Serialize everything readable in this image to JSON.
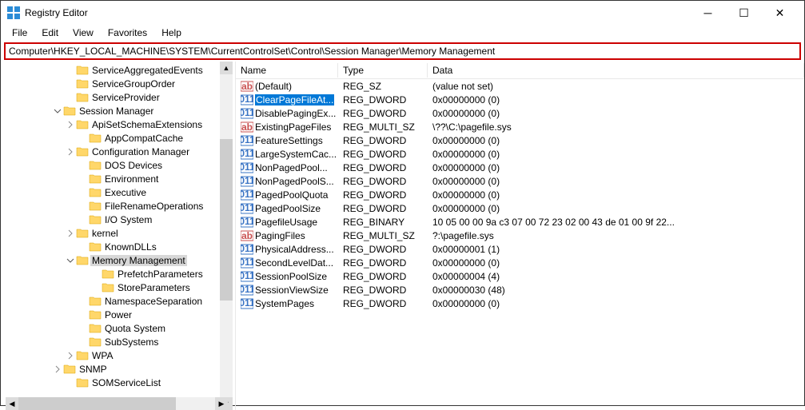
{
  "window": {
    "title": "Registry Editor"
  },
  "menu": {
    "file": "File",
    "edit": "Edit",
    "view": "View",
    "favorites": "Favorites",
    "help": "Help"
  },
  "address": "Computer\\HKEY_LOCAL_MACHINE\\SYSTEM\\CurrentControlSet\\Control\\Session Manager\\Memory Management",
  "tree": [
    {
      "depth": 5,
      "expander": "",
      "label": "ServiceAggregatedEvents",
      "selected": false
    },
    {
      "depth": 5,
      "expander": "",
      "label": "ServiceGroupOrder",
      "selected": false
    },
    {
      "depth": 5,
      "expander": "",
      "label": "ServiceProvider",
      "selected": false
    },
    {
      "depth": 4,
      "expander": "v",
      "label": "Session Manager",
      "selected": false,
      "hasExpander": true
    },
    {
      "depth": 5,
      "expander": ">",
      "label": "ApiSetSchemaExtensions",
      "selected": false,
      "hasExpander": true
    },
    {
      "depth": 6,
      "expander": "",
      "label": "AppCompatCache",
      "selected": false
    },
    {
      "depth": 5,
      "expander": ">",
      "label": "Configuration Manager",
      "selected": false,
      "hasExpander": true
    },
    {
      "depth": 6,
      "expander": "",
      "label": "DOS Devices",
      "selected": false
    },
    {
      "depth": 6,
      "expander": "",
      "label": "Environment",
      "selected": false
    },
    {
      "depth": 6,
      "expander": "",
      "label": "Executive",
      "selected": false
    },
    {
      "depth": 6,
      "expander": "",
      "label": "FileRenameOperations",
      "selected": false
    },
    {
      "depth": 6,
      "expander": "",
      "label": "I/O System",
      "selected": false
    },
    {
      "depth": 5,
      "expander": ">",
      "label": "kernel",
      "selected": false,
      "hasExpander": true
    },
    {
      "depth": 6,
      "expander": "",
      "label": "KnownDLLs",
      "selected": false
    },
    {
      "depth": 5,
      "expander": "v",
      "label": "Memory Management",
      "selected": true,
      "hasExpander": true
    },
    {
      "depth": 7,
      "expander": "",
      "label": "PrefetchParameters",
      "selected": false
    },
    {
      "depth": 7,
      "expander": "",
      "label": "StoreParameters",
      "selected": false
    },
    {
      "depth": 6,
      "expander": "",
      "label": "NamespaceSeparation",
      "selected": false
    },
    {
      "depth": 6,
      "expander": "",
      "label": "Power",
      "selected": false
    },
    {
      "depth": 6,
      "expander": "",
      "label": "Quota System",
      "selected": false
    },
    {
      "depth": 6,
      "expander": "",
      "label": "SubSystems",
      "selected": false
    },
    {
      "depth": 5,
      "expander": ">",
      "label": "WPA",
      "selected": false,
      "hasExpander": true
    },
    {
      "depth": 4,
      "expander": ">",
      "label": "SNMP",
      "selected": false,
      "hasExpander": true
    },
    {
      "depth": 5,
      "expander": "",
      "label": "SOMServiceList",
      "selected": false
    }
  ],
  "columns": {
    "name": "Name",
    "type": "Type",
    "data": "Data"
  },
  "values": [
    {
      "icon": "str",
      "name": "(Default)",
      "type": "REG_SZ",
      "data": "(value not set)",
      "selected": false
    },
    {
      "icon": "bin",
      "name": "ClearPageFileAt...",
      "type": "REG_DWORD",
      "data": "0x00000000 (0)",
      "selected": true
    },
    {
      "icon": "bin",
      "name": "DisablePagingEx...",
      "type": "REG_DWORD",
      "data": "0x00000000 (0)",
      "selected": false
    },
    {
      "icon": "str",
      "name": "ExistingPageFiles",
      "type": "REG_MULTI_SZ",
      "data": "\\??\\C:\\pagefile.sys",
      "selected": false
    },
    {
      "icon": "bin",
      "name": "FeatureSettings",
      "type": "REG_DWORD",
      "data": "0x00000000 (0)",
      "selected": false
    },
    {
      "icon": "bin",
      "name": "LargeSystemCac...",
      "type": "REG_DWORD",
      "data": "0x00000000 (0)",
      "selected": false
    },
    {
      "icon": "bin",
      "name": "NonPagedPool...",
      "type": "REG_DWORD",
      "data": "0x00000000 (0)",
      "selected": false
    },
    {
      "icon": "bin",
      "name": "NonPagedPoolS...",
      "type": "REG_DWORD",
      "data": "0x00000000 (0)",
      "selected": false
    },
    {
      "icon": "bin",
      "name": "PagedPoolQuota",
      "type": "REG_DWORD",
      "data": "0x00000000 (0)",
      "selected": false
    },
    {
      "icon": "bin",
      "name": "PagedPoolSize",
      "type": "REG_DWORD",
      "data": "0x00000000 (0)",
      "selected": false
    },
    {
      "icon": "bin",
      "name": "PagefileUsage",
      "type": "REG_BINARY",
      "data": "10 05 00 00 9a c3 07 00 72 23 02 00 43 de 01 00 9f 22...",
      "selected": false
    },
    {
      "icon": "str",
      "name": "PagingFiles",
      "type": "REG_MULTI_SZ",
      "data": "?:\\pagefile.sys",
      "selected": false
    },
    {
      "icon": "bin",
      "name": "PhysicalAddress...",
      "type": "REG_DWORD",
      "data": "0x00000001 (1)",
      "selected": false
    },
    {
      "icon": "bin",
      "name": "SecondLevelDat...",
      "type": "REG_DWORD",
      "data": "0x00000000 (0)",
      "selected": false
    },
    {
      "icon": "bin",
      "name": "SessionPoolSize",
      "type": "REG_DWORD",
      "data": "0x00000004 (4)",
      "selected": false
    },
    {
      "icon": "bin",
      "name": "SessionViewSize",
      "type": "REG_DWORD",
      "data": "0x00000030 (48)",
      "selected": false
    },
    {
      "icon": "bin",
      "name": "SystemPages",
      "type": "REG_DWORD",
      "data": "0x00000000 (0)",
      "selected": false
    }
  ]
}
